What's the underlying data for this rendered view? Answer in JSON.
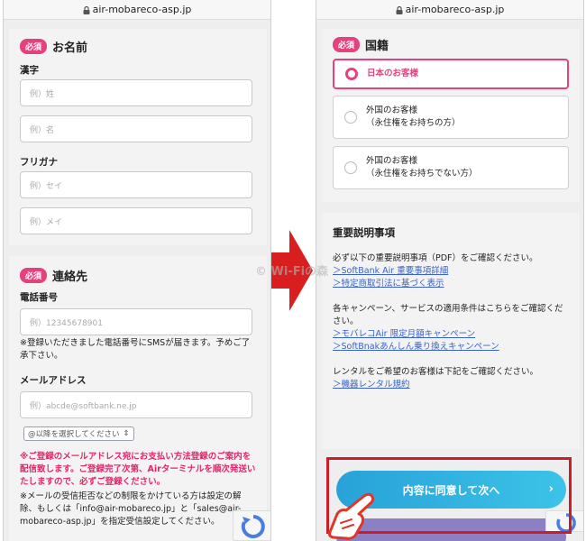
{
  "left": {
    "url": "air-mobareco-asp.jp",
    "name_section": {
      "badge": "必須",
      "title": "お名前",
      "kanji_label": "漢字",
      "sei_placeholder": "例）姓",
      "mei_placeholder": "例）名",
      "furigana_label": "フリガナ",
      "sei_kana_placeholder": "例）セイ",
      "mei_kana_placeholder": "例）メイ"
    },
    "contact_section": {
      "badge": "必須",
      "title": "連絡先",
      "phone_label": "電話番号",
      "phone_placeholder": "例）12345678901",
      "phone_note": "※登録いただきました電話番号にSMSが届きます。予めご了承下さい。",
      "email_label": "メールアドレス",
      "email_placeholder": "例）abcde@softbank.ne.jp",
      "domain_select": "@以降を選択してください",
      "red_note": "※ご登録のメールアドレス宛にお支払い方法登録のご案内を配信致します。ご登録完了次第、Airターミナルを順次発送いたしますので、必ずご登録ください。",
      "filter_note": "※メールの受信拒否などの制限をかけている方は設定の解除、もしくは「info@air-mobareco.jp」と「sales@air-mobareco-asp.jp」を指定受信設定してください。"
    }
  },
  "right": {
    "url": "air-mobareco-asp.jp",
    "nationality": {
      "badge": "必須",
      "title": "国籍",
      "options": [
        {
          "line1": "日本のお客様",
          "line2": ""
        },
        {
          "line1": "外国のお客様",
          "line2": "（永住権をお持ちの方）"
        },
        {
          "line1": "外国のお客様",
          "line2": "（永住権をお持ちでない方）"
        }
      ]
    },
    "important": {
      "title": "重要説明事項",
      "intro": "必ず以下の重要説明事項（PDF）をご確認ください。",
      "link1": "＞SoftBank Air 重要事項詳細",
      "link2": "＞特定商取引法に基づく表示",
      "campaign_intro": "各キャンペーン、サービスの適用条件はこちらをご確認ください。",
      "link3": "＞モバレコAir 限定月額キャンペーン",
      "link4": "＞SoftBnakあんしん乗り換えキャンペーン",
      "rental_intro": "レンタルをご希望のお客様は下記をご確認ください。",
      "link5": "＞機器レンタル規約"
    },
    "agree_button": "内容に同意して次へ"
  },
  "watermark": "© Wi-Fiの森",
  "colors": {
    "badge_pink": "#e6417f",
    "red_note": "#e2266c",
    "link_blue": "#3a62c8",
    "button_blue": "#28a2d8",
    "highlight_red": "#cc1c25",
    "arrow_red": "#d81e1e"
  }
}
